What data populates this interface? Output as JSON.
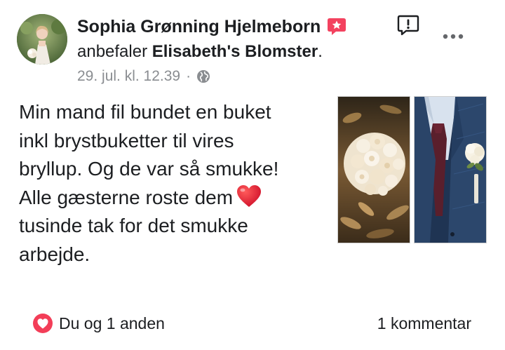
{
  "header": {
    "author_name": "Sophia Grønning Hjelmeborn",
    "recommends_prefix": "anbefaler",
    "page_name": "Elisabeth's Blomster",
    "recommends_suffix": ".",
    "timestamp": "29. jul. kl. 12.39",
    "separator": "·",
    "privacy_icon": "globe-icon",
    "badge_icon": "recommendation-badge-icon",
    "report_icon": "report-icon",
    "more_icon": "more-options-icon"
  },
  "post": {
    "lines": [
      "Min mand fil bundet en buket",
      "inkl brystbuketter til vires",
      "bryllup. Og de var så smukke!",
      "Alle gæsterne roste dem",
      "tusinde tak for det smukke",
      "arbejde."
    ],
    "emoji": "heart-emoji"
  },
  "photos": [
    {
      "name": "bouquet-photo"
    },
    {
      "name": "boutonniere-photo"
    }
  ],
  "footer": {
    "reactions_text": "Du og 1 anden",
    "reaction_icon": "love-reaction-icon",
    "comments_text": "1 kommentar"
  },
  "colors": {
    "text": "#1c1e21",
    "meta": "#8a8d91",
    "badge": "#f3425f",
    "heart": "#e41e3f",
    "love_reaction": "#f33e58"
  }
}
